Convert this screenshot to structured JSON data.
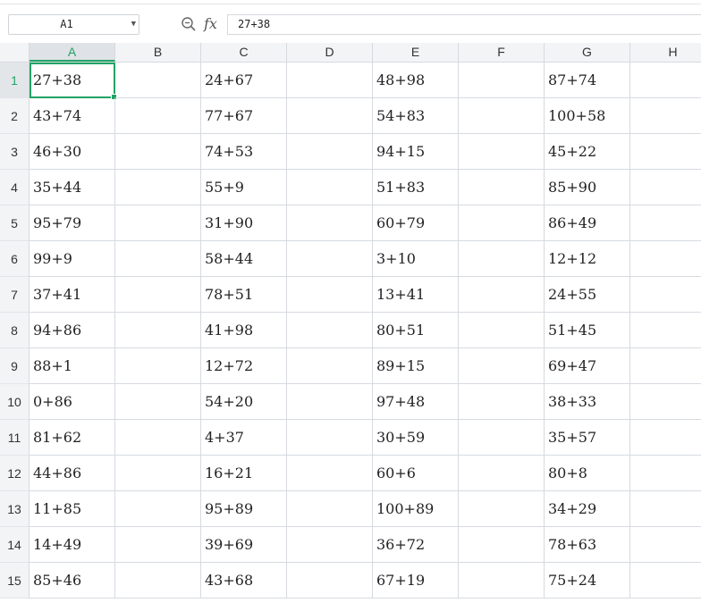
{
  "name_box": {
    "value": "A1"
  },
  "formula": {
    "fx_label": "fx",
    "value": "27+38"
  },
  "columns": [
    "A",
    "B",
    "C",
    "D",
    "E",
    "F",
    "G",
    "H"
  ],
  "active_column": "A",
  "active_row": "1",
  "accent_color": "#21a366",
  "rows": [
    {
      "num": "1",
      "A": "27+38",
      "B": "",
      "C": "24+67",
      "D": "",
      "E": "48+98",
      "F": "",
      "G": "87+74",
      "H": ""
    },
    {
      "num": "2",
      "A": "43+74",
      "B": "",
      "C": "77+67",
      "D": "",
      "E": "54+83",
      "F": "",
      "G": "100+58",
      "H": ""
    },
    {
      "num": "3",
      "A": "46+30",
      "B": "",
      "C": "74+53",
      "D": "",
      "E": "94+15",
      "F": "",
      "G": "45+22",
      "H": ""
    },
    {
      "num": "4",
      "A": "35+44",
      "B": "",
      "C": "55+9",
      "D": "",
      "E": "51+83",
      "F": "",
      "G": "85+90",
      "H": ""
    },
    {
      "num": "5",
      "A": "95+79",
      "B": "",
      "C": "31+90",
      "D": "",
      "E": "60+79",
      "F": "",
      "G": "86+49",
      "H": ""
    },
    {
      "num": "6",
      "A": "99+9",
      "B": "",
      "C": "58+44",
      "D": "",
      "E": "3+10",
      "F": "",
      "G": "12+12",
      "H": ""
    },
    {
      "num": "7",
      "A": "37+41",
      "B": "",
      "C": "78+51",
      "D": "",
      "E": "13+41",
      "F": "",
      "G": "24+55",
      "H": ""
    },
    {
      "num": "8",
      "A": "94+86",
      "B": "",
      "C": "41+98",
      "D": "",
      "E": "80+51",
      "F": "",
      "G": "51+45",
      "H": ""
    },
    {
      "num": "9",
      "A": "88+1",
      "B": "",
      "C": "12+72",
      "D": "",
      "E": "89+15",
      "F": "",
      "G": "69+47",
      "H": ""
    },
    {
      "num": "10",
      "A": "0+86",
      "B": "",
      "C": "54+20",
      "D": "",
      "E": "97+48",
      "F": "",
      "G": "38+33",
      "H": ""
    },
    {
      "num": "11",
      "A": "81+62",
      "B": "",
      "C": "4+37",
      "D": "",
      "E": "30+59",
      "F": "",
      "G": "35+57",
      "H": ""
    },
    {
      "num": "12",
      "A": "44+86",
      "B": "",
      "C": "16+21",
      "D": "",
      "E": "60+6",
      "F": "",
      "G": "80+8",
      "H": ""
    },
    {
      "num": "13",
      "A": "11+85",
      "B": "",
      "C": "95+89",
      "D": "",
      "E": "100+89",
      "F": "",
      "G": "34+29",
      "H": ""
    },
    {
      "num": "14",
      "A": "14+49",
      "B": "",
      "C": "39+69",
      "D": "",
      "E": "36+72",
      "F": "",
      "G": "78+63",
      "H": ""
    },
    {
      "num": "15",
      "A": "85+46",
      "B": "",
      "C": "43+68",
      "D": "",
      "E": "67+19",
      "F": "",
      "G": "75+24",
      "H": ""
    }
  ]
}
